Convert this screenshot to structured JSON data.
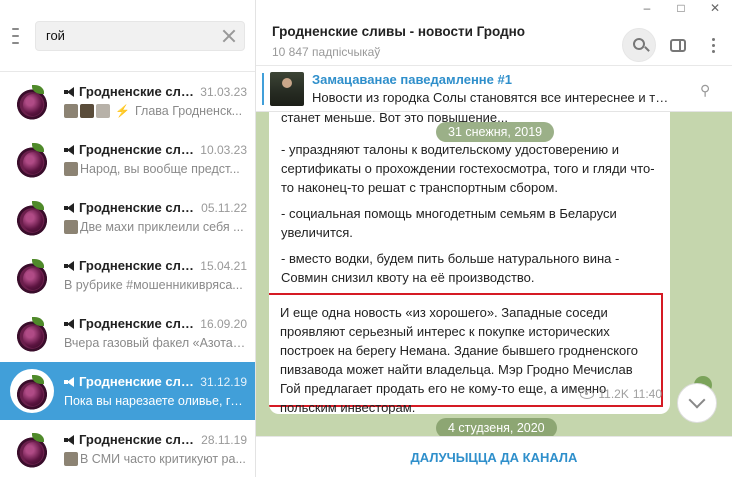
{
  "window": {
    "controls": [
      "–",
      "□",
      "✕"
    ]
  },
  "sidebar": {
    "search": {
      "value": "гой",
      "placeholder": ""
    },
    "chats": [
      {
        "title": "Гродненские сливы",
        "date": "31.03.23",
        "preview": "Глава Гродненск...",
        "thumbs": 3,
        "bolt": true,
        "active": false
      },
      {
        "title": "Гродненские сливы",
        "date": "10.03.23",
        "preview": "Народ, вы вообще предст...",
        "thumbs": 1,
        "bolt": false,
        "active": false
      },
      {
        "title": "Гродненские сливы",
        "date": "05.11.22",
        "preview": "Две махи приклеили себя ...",
        "thumbs": 1,
        "bolt": false,
        "active": false
      },
      {
        "title": "Гродненские сливы",
        "date": "15.04.21",
        "preview": "В рубрике #мошенникивряса...",
        "thumbs": 0,
        "bolt": false,
        "active": false
      },
      {
        "title": "Гродненские сливы",
        "date": "16.09.20",
        "preview": "Вчера газовый факел «Азота»...",
        "thumbs": 0,
        "bolt": false,
        "active": false
      },
      {
        "title": "Гродненские сливы",
        "date": "31.12.19",
        "preview": "Пока вы нарезаете оливье, го...",
        "thumbs": 0,
        "bolt": false,
        "active": true
      },
      {
        "title": "Гродненские сливы",
        "date": "28.11.19",
        "preview": "В СМИ часто критикуют ра...",
        "thumbs": 1,
        "bolt": false,
        "active": false
      }
    ]
  },
  "header": {
    "title": "Гродненские сливы - новости Гродно",
    "subtitle": "10 847 падпісчыкаў"
  },
  "pinned": {
    "title": "Замацаванае паведамленне #1",
    "text": "Новости из городка Солы становятся все интереснее и трево..."
  },
  "message": {
    "p0": "станет меньше. Вот это повышение...",
    "p1": "- упраздняют талоны к водительскому удостоверению и сертификаты о прохождении гостехосмотра, того и гляди что-то наконец-то решат с транспортным сбором.",
    "p2": "- социальная помощь многодетным семьям в Беларуси увеличится.",
    "p3": "- вместо водки, будем пить больше натурального вина - Совмин снизил квоту на её производство.",
    "highlight": "И еще одна новость «из хорошего». Западные соседи проявляют серьезный интерес к покупке исторических построек на берегу Немана. Здание бывшего гродненского пивзавода может найти владельца. Мэр Гродно Мечислав Гой предлагает продать его не кому-то еще, а именно польским инвесторам.",
    "views": "11.2K",
    "time": "11:40"
  },
  "dates": {
    "top": "31 снежня, 2019",
    "bottom": "4 студзеня, 2020"
  },
  "join_label": "ДАЛУЧЫЦЦА ДА КАНАЛА",
  "colors": {
    "accent": "#419fd9",
    "highlight_border": "#d51a24",
    "chat_bg": "#c5d6ad"
  }
}
